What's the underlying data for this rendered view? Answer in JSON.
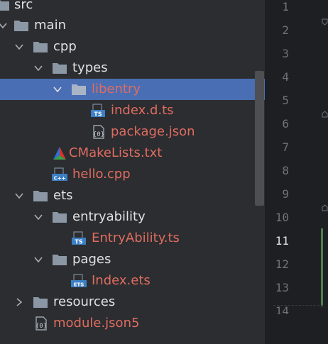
{
  "tree": {
    "rows": [
      {
        "label": "src"
      },
      {
        "label": "main"
      },
      {
        "label": "cpp"
      },
      {
        "label": "types"
      },
      {
        "label": "libentry"
      },
      {
        "label": "index.d.ts",
        "badge": "TS"
      },
      {
        "label": "package.json"
      },
      {
        "label": "CMakeLists.txt"
      },
      {
        "label": "hello.cpp",
        "badge": "C++"
      },
      {
        "label": "ets"
      },
      {
        "label": "entryability"
      },
      {
        "label": "EntryAbility.ts",
        "badge": "TS"
      },
      {
        "label": "pages"
      },
      {
        "label": "Index.ets",
        "badge": "ETS"
      },
      {
        "label": "resources"
      },
      {
        "label": "module.json5"
      }
    ]
  },
  "editor": {
    "line_numbers": [
      "1",
      "2",
      "3",
      "4",
      "5",
      "6",
      "7",
      "8",
      "9",
      "10",
      "11",
      "12",
      "13",
      "14"
    ],
    "current_line": "11"
  },
  "colors": {
    "panel_bg": "#2b2d30",
    "editor_bg": "#1e1f22",
    "selection": "#4a6eb4",
    "folder": "#8c97a6",
    "text": "#dfe1e5",
    "modified_text": "#e06c60"
  }
}
